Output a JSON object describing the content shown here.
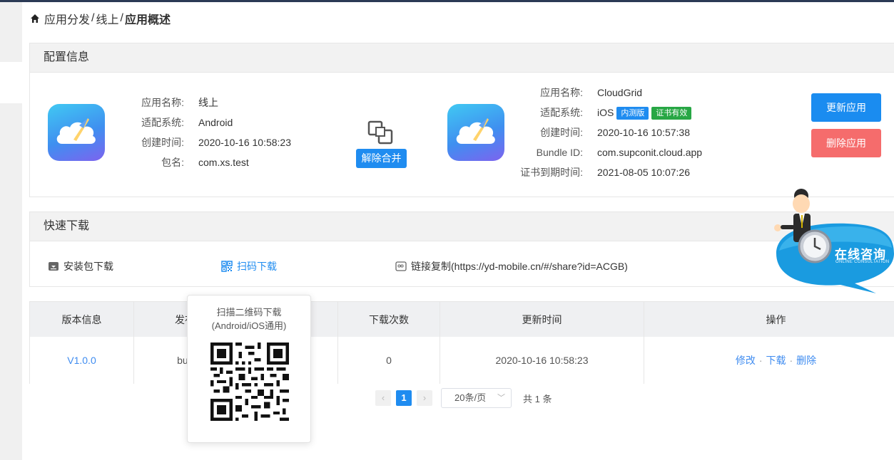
{
  "breadcrumb": {
    "items": [
      "应用分发",
      "线上",
      "应用概述"
    ],
    "separator": "/"
  },
  "config": {
    "title": "配置信息",
    "left_app": {
      "fields": [
        {
          "label": "应用名称:",
          "value": "线上"
        },
        {
          "label": "适配系统:",
          "value": "Android"
        },
        {
          "label": "创建时间:",
          "value": "2020-10-16 10:58:23"
        },
        {
          "label": "包名:",
          "value": "com.xs.test"
        }
      ]
    },
    "unmerge_label": "解除合并",
    "right_app": {
      "fields": [
        {
          "label": "应用名称:",
          "value": "CloudGrid"
        },
        {
          "label": "适配系统:",
          "value": "iOS"
        },
        {
          "label": "创建时间:",
          "value": "2020-10-16 10:57:38"
        },
        {
          "label": "Bundle ID:",
          "value": "com.supconit.cloud.app"
        },
        {
          "label": "证书到期时间:",
          "value": "2021-08-05 10:07:26"
        }
      ],
      "tags": [
        {
          "text": "内测版",
          "color": "#1f8cf0"
        },
        {
          "text": "证书有效",
          "color": "#28a745"
        }
      ]
    },
    "update_button": "更新应用",
    "delete_button": "删除应用"
  },
  "download": {
    "title": "快速下载",
    "package_label": "安装包下载",
    "qr_label": "扫码下载",
    "link_label": "链接复制(https://yd-mobile.cn/#/share?id=ACGB)"
  },
  "table": {
    "headers": [
      "版本信息",
      "发布",
      "",
      "下载次数",
      "更新时间",
      "操作"
    ],
    "rows": [
      {
        "version": "V1.0.0",
        "build": "buil",
        "col3": "",
        "downloads": "0",
        "updated": "2020-10-16 10:58:23",
        "actions": [
          "修改",
          "下载",
          "删除"
        ]
      }
    ]
  },
  "pagination": {
    "current": "1",
    "page_size": "20条/页",
    "total": "共 1 条"
  },
  "popover": {
    "line1": "扫描二维码下载",
    "line2": "(Android/iOS通用)"
  },
  "consult": {
    "title": "在线咨询",
    "subtitle": "ONLINE CONSULTATION"
  },
  "colors": {
    "primary": "#1f8cf0",
    "danger": "#f56c6c",
    "success": "#28a745",
    "link": "#3f8cf0"
  }
}
